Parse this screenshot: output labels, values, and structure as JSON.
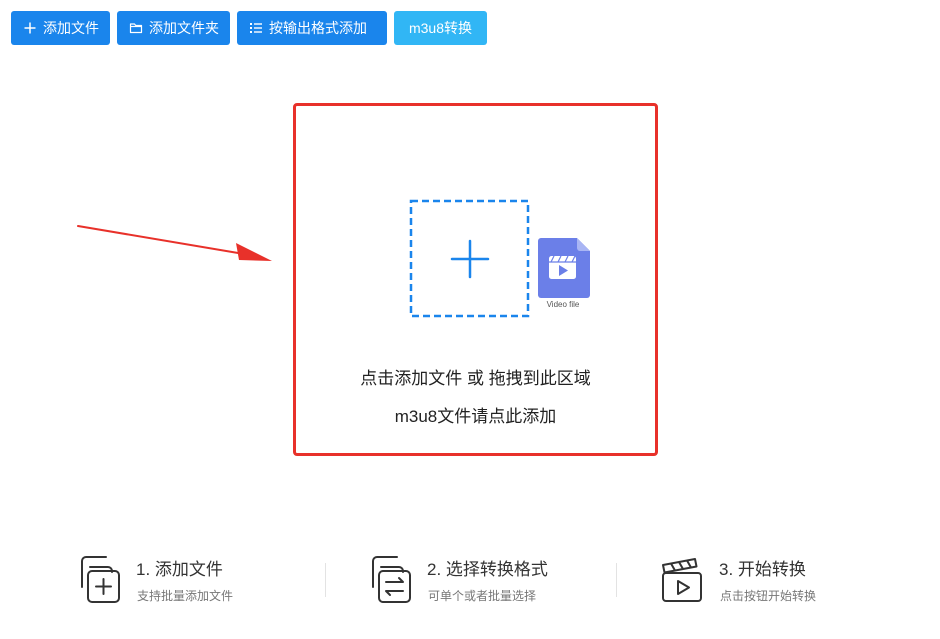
{
  "toolbar": {
    "add_file": {
      "label": "添加文件",
      "icon": "plus-icon"
    },
    "add_folder": {
      "label": "添加文件夹",
      "icon": "folder-icon"
    },
    "add_by_format": {
      "label": "按输出格式添加",
      "icon": "list-icon"
    },
    "m3u8_convert": {
      "label": "m3u8转换"
    }
  },
  "dropzone": {
    "line1": "点击添加文件 或 拖拽到此区域",
    "line2": "m3u8文件请点此添加",
    "video_file_label": "Video file",
    "icons": [
      "plus-icon",
      "video-file-icon"
    ]
  },
  "steps": [
    {
      "title": "1. 添加文件",
      "desc": "支持批量添加文件",
      "icon": "add-files-icon"
    },
    {
      "title": "2. 选择转换格式",
      "desc": "可单个或者批量选择",
      "icon": "convert-format-icon"
    },
    {
      "title": "3. 开始转换",
      "desc": "点击按钮开始转换",
      "icon": "clapperboard-play-icon"
    }
  ],
  "colors": {
    "primary_button": "#1a85ec",
    "m3u8_button": "#31b6f5",
    "highlight_border": "#e8312a",
    "dashed_border": "#1a85ec",
    "video_icon": "#6b7fe8"
  }
}
